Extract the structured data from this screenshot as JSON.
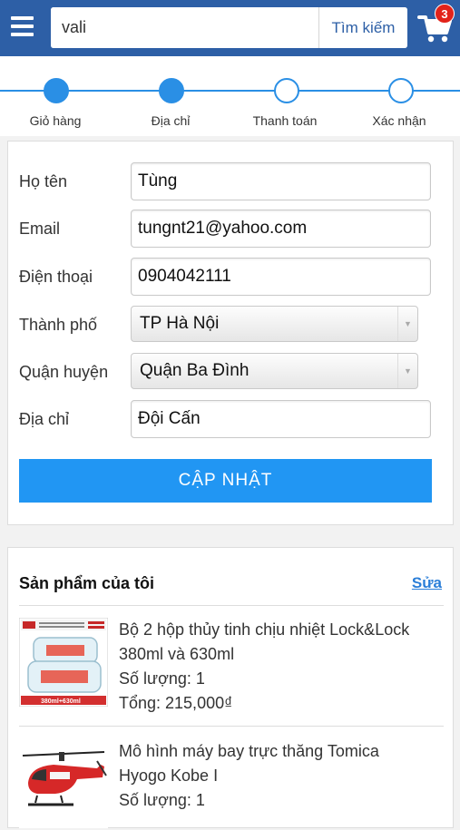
{
  "header": {
    "search_value": "vali",
    "search_button": "Tìm kiếm",
    "cart_count": "3",
    "brand_color": "#2d5fa6"
  },
  "stepper": {
    "steps": [
      {
        "label": "Giỏ hàng",
        "state": "done"
      },
      {
        "label": "Địa chỉ",
        "state": "active"
      },
      {
        "label": "Thanh toán",
        "state": "pending"
      },
      {
        "label": "Xác nhận",
        "state": "pending"
      }
    ],
    "accent": "#2a8fe5"
  },
  "form": {
    "fields": [
      {
        "label": "Họ tên",
        "value": "Tùng"
      },
      {
        "label": "Email",
        "value": "tungnt21@yahoo.com"
      },
      {
        "label": "Điện thoại",
        "value": "0904042111"
      },
      {
        "label": "Thành phố",
        "value": "TP Hà Nội"
      },
      {
        "label": "Quận huyện",
        "value": "Quận Ba Đình"
      },
      {
        "label": "Địa chỉ",
        "value": "Đội Cấn"
      }
    ],
    "update_button": "CẬP NHẬT",
    "button_color": "#2196f3"
  },
  "products": {
    "title": "Sản phẩm của tôi",
    "edit_link": "Sửa",
    "items": [
      {
        "name_line1": "Bộ 2 hộp thủy tinh chịu nhiệt Lock&Lock",
        "name_line2": "380ml và 630ml",
        "quantity": "Số lượng: 1",
        "total": "Tổng: 215,000₫",
        "image_icon": "glass-container-icon",
        "image_text": "380ml+630ml"
      },
      {
        "name_line1": "Mô hình máy bay trực thăng Tomica",
        "name_line2": "Hyogo Kobe I",
        "quantity": "Số lượng: 1",
        "image_icon": "helicopter-icon"
      }
    ]
  }
}
